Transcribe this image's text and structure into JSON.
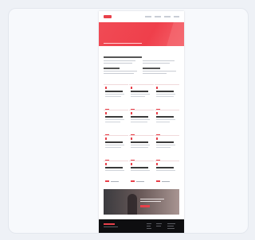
{
  "colors": {
    "accent": "#e8404a",
    "frame_bg": "#f7f9fc",
    "footer_bg": "#0e0e10"
  },
  "hero": {
    "title": ""
  },
  "intro": {
    "title": ""
  },
  "banner": {
    "text": "",
    "button_label": ""
  }
}
